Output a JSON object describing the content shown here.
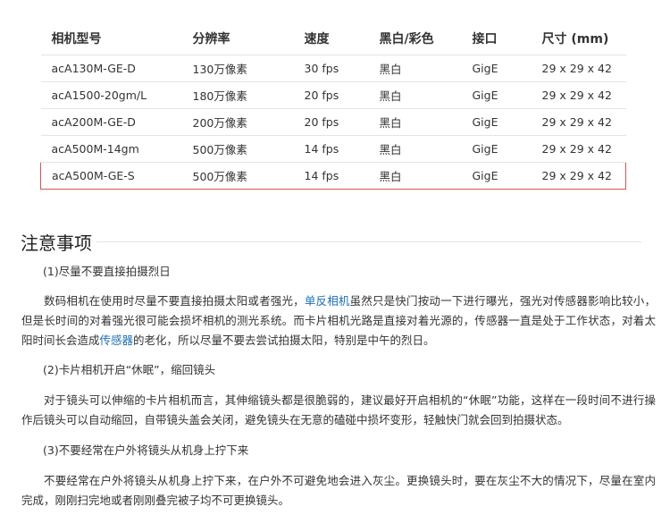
{
  "table": {
    "headers": [
      "相机型号",
      "分辨率",
      "速度",
      "黑白/彩色",
      "接口",
      "尺寸 (mm)"
    ],
    "rows": [
      [
        "acA130M-GE-D",
        "130万像素",
        "30 fps",
        "黑白",
        "GigE",
        "29 x 29 x 42"
      ],
      [
        "acA1500-20gm/L",
        "180万像素",
        "20 fps",
        "黑白",
        "GigE",
        "29 x 29 x 42"
      ],
      [
        "acA200M-GE-D",
        "200万像素",
        "20 fps",
        "黑白",
        "GigE",
        "29 x 29 x 42"
      ],
      [
        "acA500M-14gm",
        "500万像素",
        "14 fps",
        "黑白",
        "GigE",
        "29 x 29 x 42"
      ],
      [
        "acA500M-GE-S",
        "500万像素",
        "14 fps",
        "黑白",
        "GigE",
        "29 x 29 x 42"
      ]
    ],
    "highlight_color": "#d9534f"
  },
  "notes": {
    "title": "注意事项",
    "items": [
      {
        "heading": "(1)尽量不要直接拍摄烈日",
        "text_before": "数码相机在使用时尽量不要直接拍摄太阳或者强光，",
        "link1": "单反相机",
        "text_middle": "虽然只是快门按动一下进行曝光，强光对传感器影响比较小，但是长时间的对着强光很可能会损坏相机的测光系统。而卡片相机光路是直接对着光源的，传感器一直是处于工作状态，对着太阳时间长会造成",
        "link2": "传感器",
        "text_after": "的老化，所以尽量不要去尝试拍摄太阳，特别是中午的烈日。"
      },
      {
        "heading": "(2)卡片相机开启“休眠”，缩回镜头",
        "text": "对于镜头可以伸缩的卡片相机而言，其伸缩镜头都是很脆弱的，建议最好开启相机的“休眠”功能，这样在一段时间不进行操作后镜头可以自动缩回，自带镜头盖会关闭，避免镜头在无意的磕碰中损坏变形，轻触快门就会回到拍摄状态。"
      },
      {
        "heading": "(3)不要经常在户外将镜头从机身上拧下来",
        "text": "不要经常在户外将镜头从机身上拧下来，在户外不可避免地会进入灰尘。更换镜头时，要在灰尘不大的情况下，尽量在室内完成，刚刚扫完地或者刚刚叠完被子均不可更换镜头。"
      }
    ],
    "link_color": "#1a6fb5"
  }
}
